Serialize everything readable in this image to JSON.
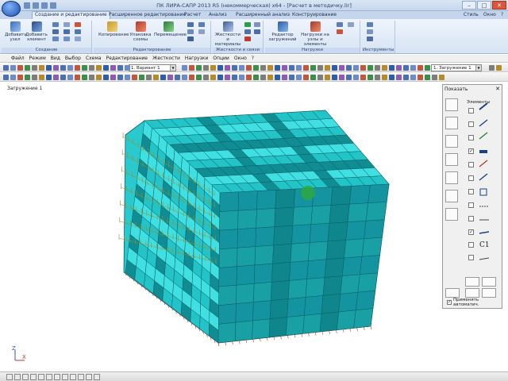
{
  "window": {
    "title": "ПК ЛИРА-САПР  2013 R5 (некоммерческая) x64 - [Расчет в методичку.lir]",
    "buttons": {
      "minimize": "–",
      "maximize": "□",
      "close": "✕"
    }
  },
  "ribbon_tabs": [
    "Создание и редактирование",
    "Расширенное редактирование",
    "Расчет",
    "Анализ",
    "Расширенный анализ",
    "Конструирование"
  ],
  "ribbon_tabs_right": [
    "Стиль",
    "Окно",
    "?"
  ],
  "ribbon": {
    "groups": {
      "sozdanie": "Создание",
      "redaktirovanie": "Редактирование",
      "zhestkosti": "Жесткости и связи",
      "nagruzki": "Нагрузки",
      "instrumenty": "Инструменты"
    },
    "buttons": {
      "add_node": "Добавить узел",
      "add_element": "Добавить элемент",
      "copy": "Копирование",
      "pack_schema": "Упаковка схемы",
      "move": "Перемещение",
      "stiffness": "Жесткости и материалы",
      "load_editor": "Редактор загружений",
      "loads_on_nodes": "Нагрузки на узлы и элементы"
    }
  },
  "menu": [
    "Файл",
    "Режим",
    "Вид",
    "Выбор",
    "Схема",
    "Редактирование",
    "Жесткости",
    "Нагрузки",
    "Опции",
    "Окно",
    "?"
  ],
  "toolbar": {
    "variant_combo": "1. Вариант 1",
    "load_combo": "1. Загружение 1"
  },
  "viewport": {
    "load_label": "Загружение 1",
    "axis_z": "Z",
    "axis_x": "X"
  },
  "panel": {
    "title": "Показать",
    "close": "✕",
    "subtitle": "Элементы",
    "c1_label": "C1",
    "apply_auto": "Применять автоматич.",
    "apply_checked": "✓"
  },
  "colors": {
    "ribbon_blue": "#d7e4f4",
    "building_cyan": "#22c4c8",
    "building_dark": "#0f8d92",
    "building_light": "#40e0e2",
    "grid_line": "#0b5f66",
    "load_arrows": "#9c8f2a"
  }
}
